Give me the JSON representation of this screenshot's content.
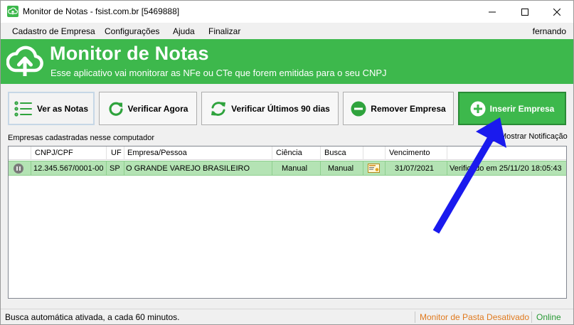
{
  "window": {
    "title": "Monitor de Notas - fsist.com.br [5469888]"
  },
  "menu": {
    "items": [
      "Cadastro de Empresa",
      "Configurações",
      "Ajuda",
      "Finalizar"
    ],
    "user": "fernando"
  },
  "header": {
    "title": "Monitor de Notas",
    "subtitle": "Esse aplicativo vai monitorar as NFe ou CTe que forem emitidas para o seu CNPJ",
    "color": "#3db84c"
  },
  "toolbar": {
    "ver_notas": "Ver as Notas",
    "verificar_agora": "Verificar Agora",
    "verificar_90": "Verificar Últimos 90 dias",
    "remover": "Remover Empresa",
    "inserir": "Inserir Empresa"
  },
  "list": {
    "caption": "Empresas cadastradas nesse computador",
    "notification_label": "Mostrar Notificação",
    "notification_checked": false,
    "columns": [
      "CNPJ/CPF",
      "UF",
      "Empresa/Pessoa",
      "Ciência",
      "Busca",
      "",
      "Vencimento",
      ""
    ],
    "rows": [
      {
        "status_icon": "pause-icon",
        "cnpj": "12.345.567/0001-00",
        "uf": "SP",
        "empresa": "O GRANDE VAREJO BRASILEIRO",
        "ciencia": "Manual",
        "busca": "Manual",
        "cert_icon": "certificate-icon",
        "vencimento": "31/07/2021",
        "situacao": "Verificado em 25/11/20 18:05:43"
      }
    ]
  },
  "status": {
    "left": "Busca automática ativada, a cada 60 minutos.",
    "monitor": "Monitor de Pasta Desativado",
    "online": "Online",
    "monitor_color": "#e07a1f",
    "online_color": "#2a9a36"
  },
  "annotation": {
    "arrow_color": "#1a1aee"
  }
}
